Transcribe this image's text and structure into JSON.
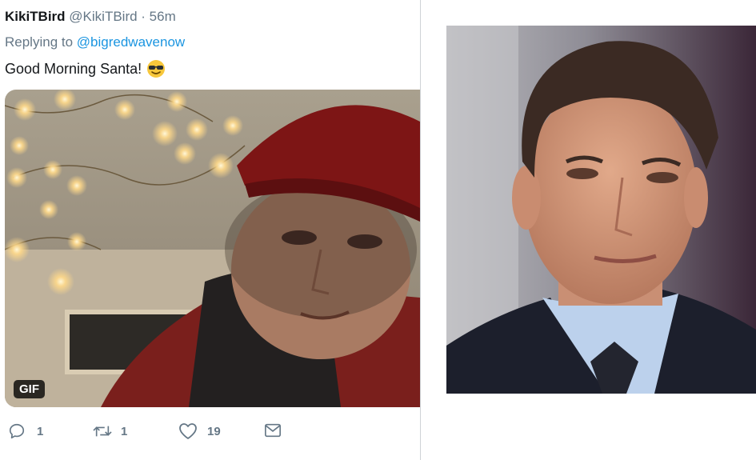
{
  "tweet": {
    "display_name": "KikiTBird",
    "handle": "@KikiTBird",
    "time": "· 56m",
    "replying_prefix": "Replying to",
    "replying_to": "@bigredwavenow",
    "text": "Good Morning Santa!",
    "emoji": "smiling-face-with-sunglasses",
    "media_badge": "GIF"
  },
  "actions": {
    "reply_count": "1",
    "retweet_count": "1",
    "like_count": "19"
  },
  "colors": {
    "link": "#1b95e0",
    "muted": "#657786",
    "text": "#14171a"
  }
}
